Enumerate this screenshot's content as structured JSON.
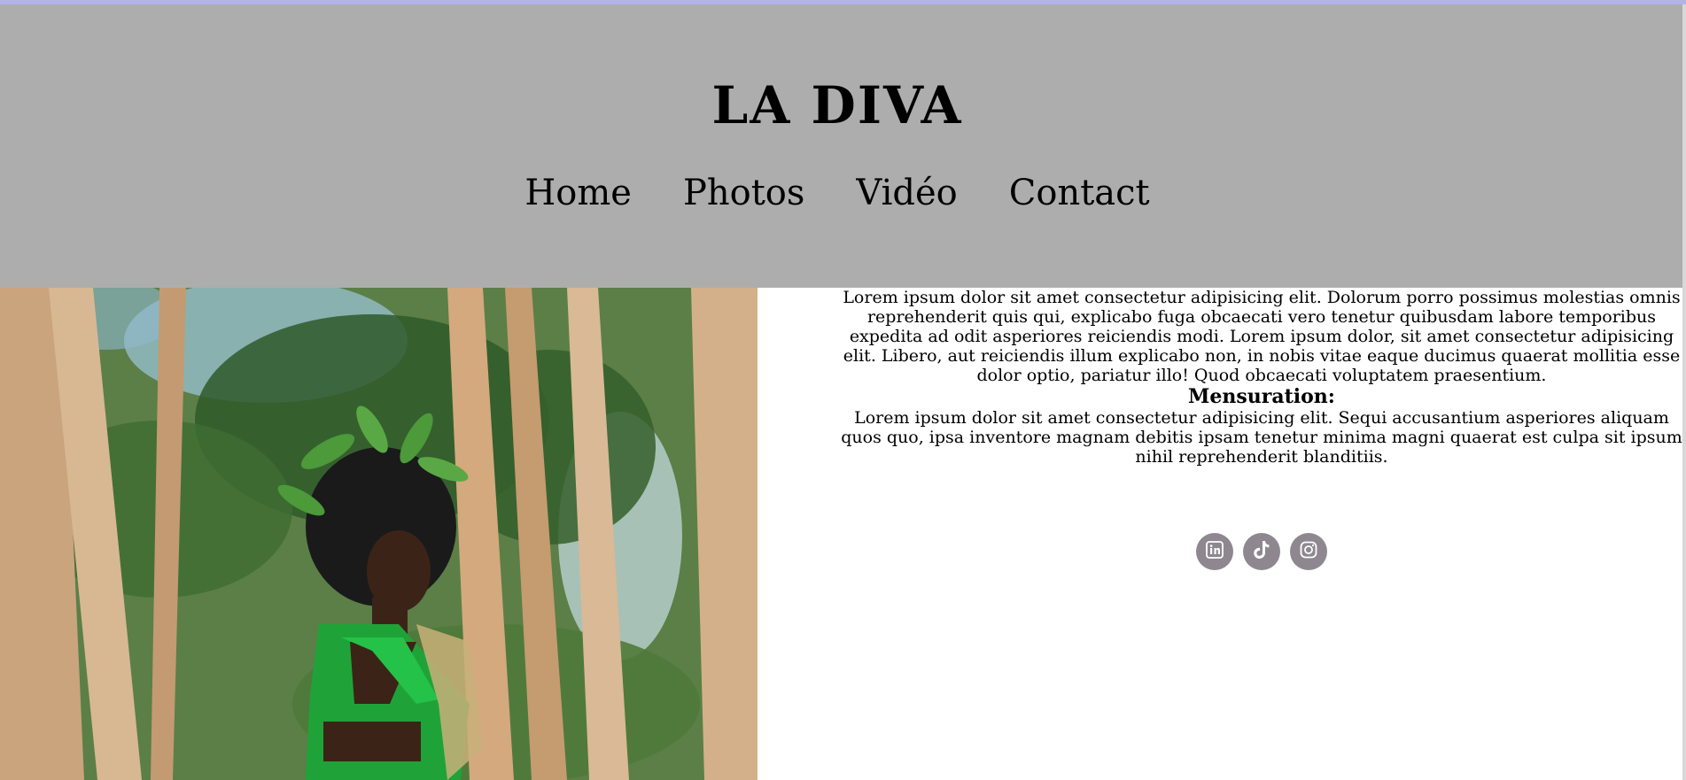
{
  "header": {
    "logo": "LA DIVA",
    "nav": [
      "Home",
      "Photos",
      "Vidéo",
      "Contact"
    ]
  },
  "main": {
    "intro": "Lorem ipsum dolor sit amet consectetur adipisicing elit. Dolorum porro possimus molestias omnis reprehenderit quis qui, explicabo fuga obcaecati vero tenetur quibusdam labore temporibus expedita ad odit asperiores reiciendis modi. Lorem ipsum dolor, sit amet consectetur adipisicing elit. Libero, aut reiciendis illum explicabo non, in nobis vitae eaque ducimus quaerat mollitia esse dolor optio, pariatur illo! Quod obcaecati voluptatem praesentium.",
    "heading": "Mensuration:",
    "body": "Lorem ipsum dolor sit amet consectetur adipisicing elit. Sequi accusantium asperiores aliquam quos quo, ipsa inventore magnam debitis ipsam tenetur minima magni quaerat est culpa sit ipsum nihil reprehenderit blanditiis."
  },
  "socials": [
    "linkedin-icon",
    "tiktok-icon",
    "instagram-icon"
  ],
  "colors": {
    "header_bg": "#adadad",
    "accent_bar": "#b3b3e6",
    "social_bg": "#8e8790"
  }
}
